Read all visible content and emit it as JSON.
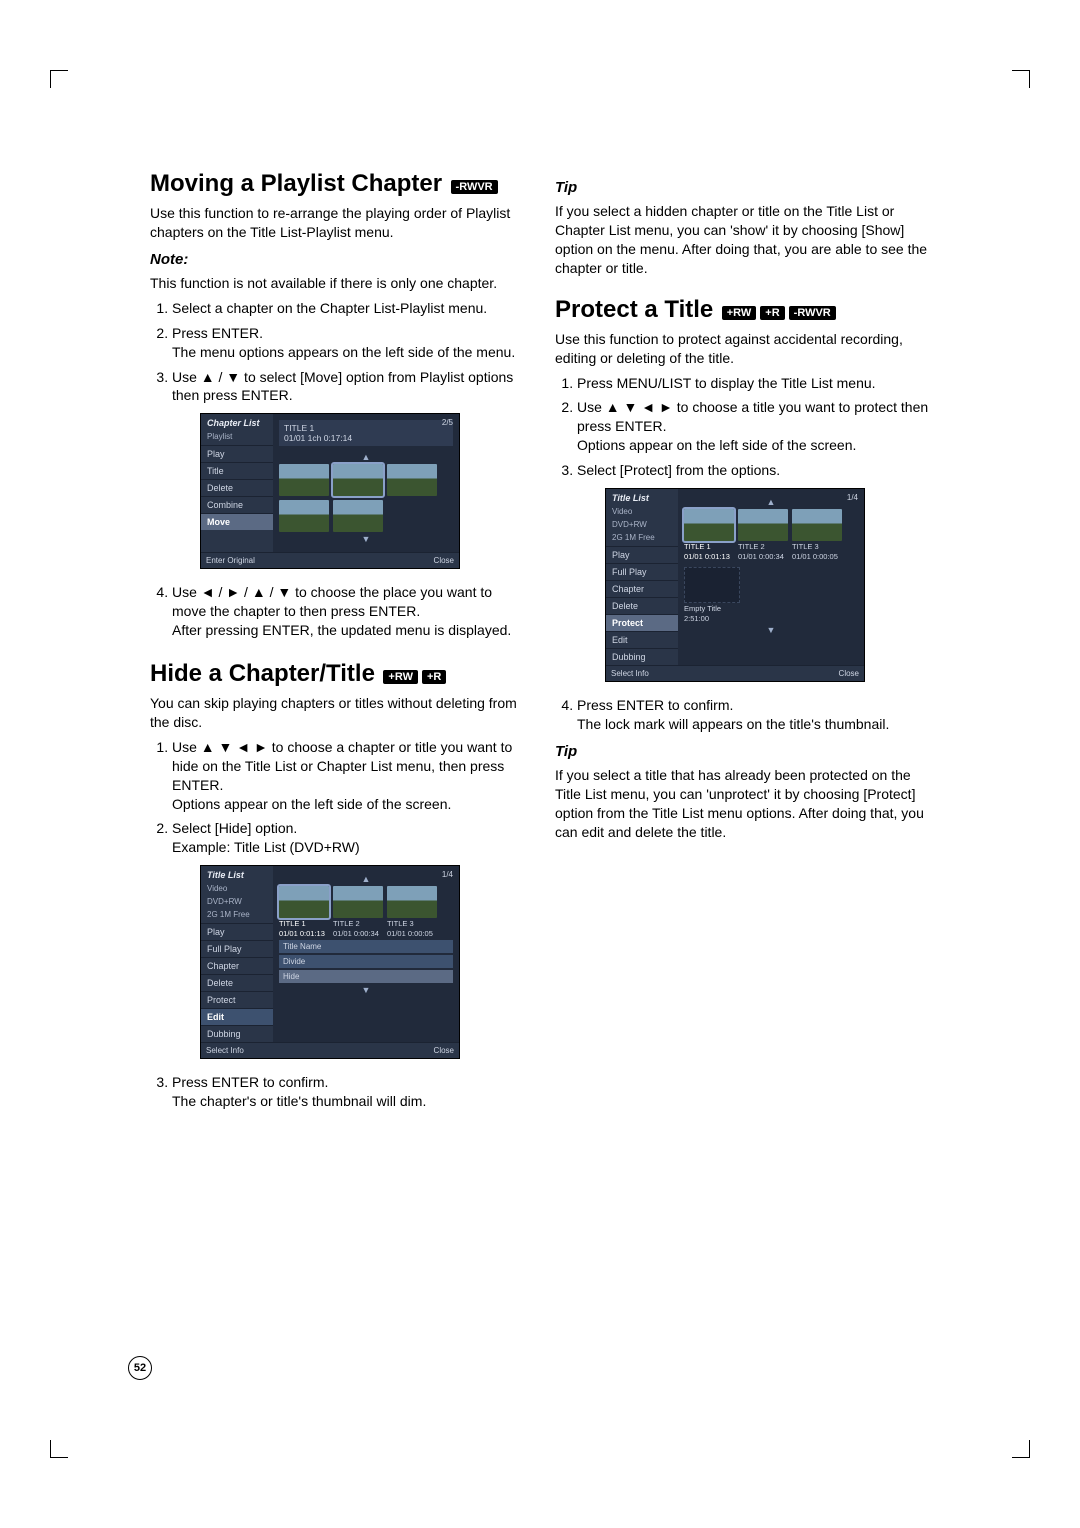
{
  "left": {
    "moving": {
      "heading": "Moving a Playlist Chapter",
      "badges": [
        "-RWVR"
      ],
      "intro": "Use this function to re-arrange the playing order of Playlist chapters on the Title List-Playlist menu.",
      "note_h": "Note:",
      "note_body": "This function is not available if there is only one chapter.",
      "steps": [
        {
          "t": "Select a chapter on the Chapter List-Playlist menu."
        },
        {
          "t": "Press ENTER.",
          "sub": "The menu options appears on the left side of the menu."
        },
        {
          "t": "Use ▲ / ▼ to select [Move] option from Playlist options then press ENTER."
        }
      ],
      "steps2": [
        {
          "t": "Use ◄ / ► / ▲ / ▼ to choose the place you want to move the chapter to then press ENTER.",
          "sub": "After pressing ENTER, the updated menu is displayed."
        }
      ],
      "shot": {
        "title": "Chapter List",
        "subtitle": "Playlist",
        "info": "TITLE 1",
        "info2": "01/01 1ch 0:17:14",
        "count": "2/5",
        "menu": [
          "Play",
          "Title",
          "Delete",
          "Combine",
          "Move"
        ],
        "foot_l": "Enter     Original",
        "foot_r": "Close"
      }
    },
    "hide": {
      "heading": "Hide a Chapter/Title",
      "badges": [
        "+RW",
        "+R"
      ],
      "intro": "You can skip playing chapters or titles without deleting from the disc.",
      "steps": [
        {
          "t": "Use ▲ ▼ ◄ ► to choose a chapter or title you want to hide on the Title List or Chapter List menu, then press ENTER.",
          "sub": "Options appear on the left side of the screen."
        },
        {
          "t": "Select [Hide] option.",
          "sub": "Example: Title List (DVD+RW)"
        }
      ],
      "steps2": [
        {
          "t": "Press ENTER to confirm.",
          "sub": "The chapter's or title's thumbnail will dim."
        }
      ],
      "shot": {
        "title": "Title List",
        "subtitle": "Video",
        "sub2": "DVD+RW",
        "free": "2G 1M Free",
        "count": "1/4",
        "titles": [
          {
            "n": "TITLE 1",
            "d": "01/01",
            "t": "0:01:13"
          },
          {
            "n": "TITLE 2",
            "d": "01/01",
            "t": "0:00:34"
          },
          {
            "n": "TITLE 3",
            "d": "01/01",
            "t": "0:00:05"
          }
        ],
        "menu": [
          "Play",
          "Full Play",
          "Chapter",
          "Delete",
          "Protect",
          "Edit",
          "Dubbing"
        ],
        "edit_sub": [
          "Title Name",
          "Divide",
          "Hide"
        ],
        "foot_l": "Select        Info",
        "foot_r": "Close"
      }
    }
  },
  "right": {
    "tip1_h": "Tip",
    "tip1_body": "If you select a hidden chapter or title on the Title List or Chapter List menu, you can 'show' it by choosing [Show] option on the menu. After doing that, you are able to see the chapter or title.",
    "protect": {
      "heading": "Protect a Title",
      "badges": [
        "+RW",
        "+R",
        "-RWVR"
      ],
      "intro": "Use this function to protect against accidental recording, editing or deleting of the title.",
      "steps": [
        {
          "t": "Press MENU/LIST to display the Title List menu."
        },
        {
          "t": "Use ▲ ▼ ◄ ► to choose a title you want to protect then press ENTER.",
          "sub": "Options appear on the left side of the screen."
        },
        {
          "t": "Select [Protect] from the options."
        }
      ],
      "steps2": [
        {
          "t": "Press ENTER to confirm.",
          "sub": "The lock mark will appears on the title's thumbnail."
        }
      ],
      "shot": {
        "title": "Title List",
        "subtitle": "Video",
        "sub2": "DVD+RW",
        "free": "2G 1M Free",
        "count": "1/4",
        "titles": [
          {
            "n": "TITLE 1",
            "d": "01/01",
            "t": "0:01:13"
          },
          {
            "n": "TITLE 2",
            "d": "01/01",
            "t": "0:00:34"
          },
          {
            "n": "TITLE 3",
            "d": "01/01",
            "t": "0:00:05"
          }
        ],
        "menu": [
          "Play",
          "Full Play",
          "Chapter",
          "Delete",
          "Protect",
          "Edit",
          "Dubbing"
        ],
        "empty": "Empty Title",
        "empty_t": "2:51:00",
        "foot_l": "Select        Info",
        "foot_r": "Close"
      },
      "tip2_h": "Tip",
      "tip2_body": "If you select a title that has already been protected on the Title List menu, you can 'unprotect' it by choosing [Protect] option from the Title List menu options. After doing that, you can edit and delete the title."
    }
  },
  "page_num": "52"
}
